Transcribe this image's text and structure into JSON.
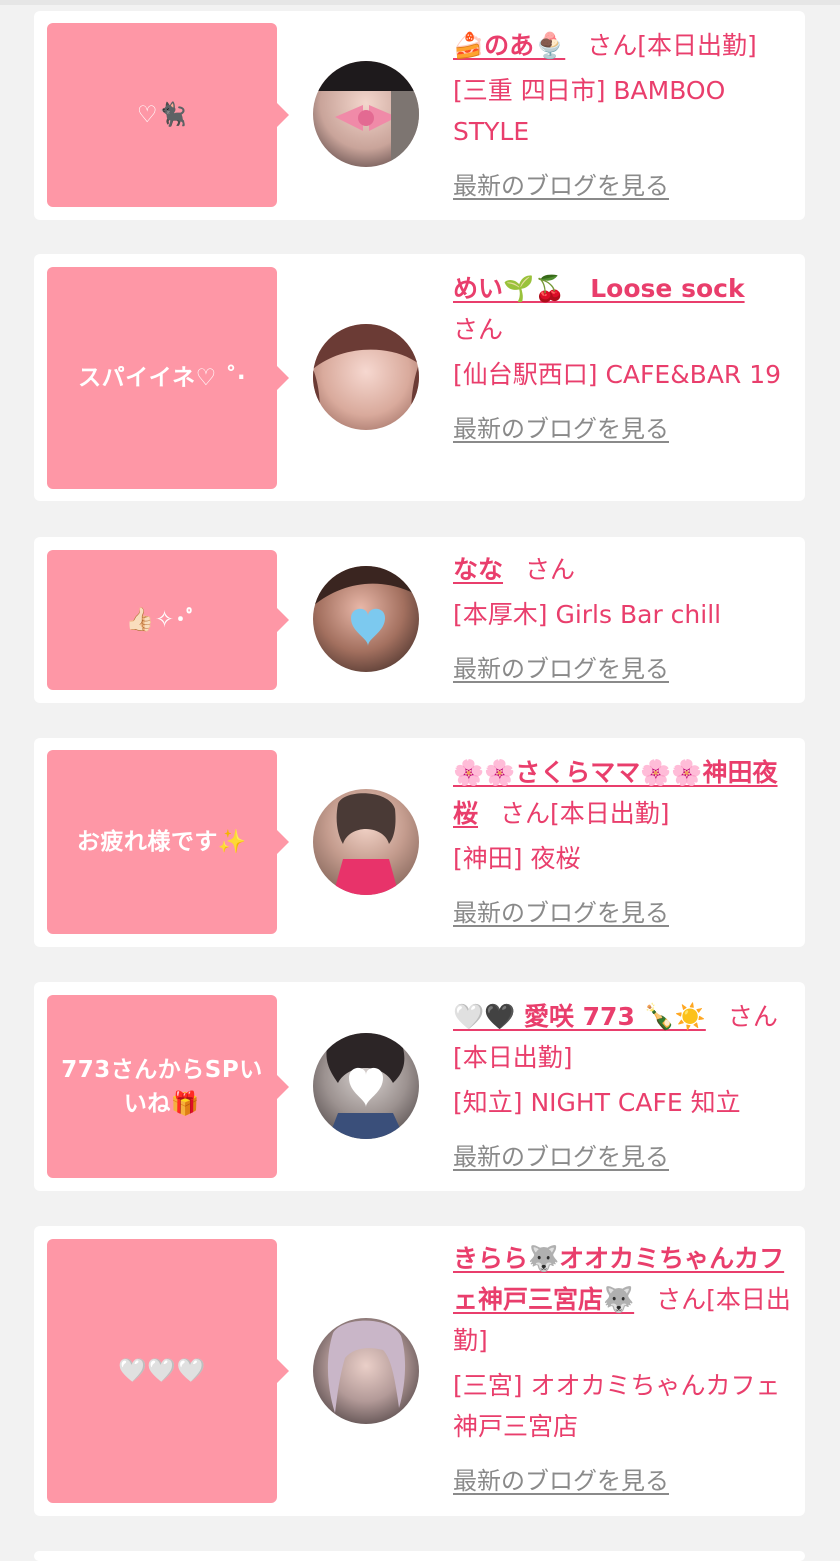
{
  "theme": {
    "background": "#f2f2f2",
    "card": "#ffffff",
    "bubble": "#fe97a6",
    "accent": "#e93e6c",
    "link_gray": "#8a8a8a"
  },
  "blog_link_label": "最新のブログを見る",
  "entries": [
    {
      "message": "♡🐈‍⬛",
      "name": "🍰のあ🍨",
      "suffix": "さん[本日出勤]",
      "shop": "[三重 四日市] BAMBOO STYLE",
      "blog": "最新のブログを見る",
      "avatar_icon": "bow-photo"
    },
    {
      "message": "スパイイネ♡ ˚‧",
      "name": "めい🌱🍒　Loose sock",
      "suffix": "さん",
      "shop": "[仙台駅西口] CAFE&BAR 19",
      "blog": "最新のブログを見る",
      "avatar_icon": "girl-photo"
    },
    {
      "message": "👍🏻✧･ﾟ",
      "name": "なな",
      "suffix": "さん",
      "shop": "[本厚木] Girls Bar chill",
      "blog": "最新のブログを見る",
      "avatar_icon": "blue-heart-photo"
    },
    {
      "message": "お疲れ様です✨",
      "name": "🌸🌸さくらママ🌸🌸神田夜桜",
      "suffix": "さん[本日出勤]",
      "shop": "[神田] 夜桜",
      "blog": "最新のブログを見る",
      "avatar_icon": "pink-dress-photo"
    },
    {
      "message": "773さんからSPいいね🎁",
      "name": "🤍🖤 愛咲 773 🍾☀️",
      "suffix": "さん[本日出勤]",
      "shop": "[知立] NIGHT CAFE 知立",
      "blog": "最新のブログを見る",
      "avatar_icon": "white-heart-photo"
    },
    {
      "message": "🤍🤍🤍",
      "name": "きらら🐺オオカミちゃんカフェ神戸三宮店🐺",
      "suffix": "さん[本日出勤]",
      "shop": "[三宮] オオカミちゃんカフェ神戸三宮店",
      "blog": "最新のブログを見る",
      "avatar_icon": "silver-hair-photo"
    }
  ]
}
